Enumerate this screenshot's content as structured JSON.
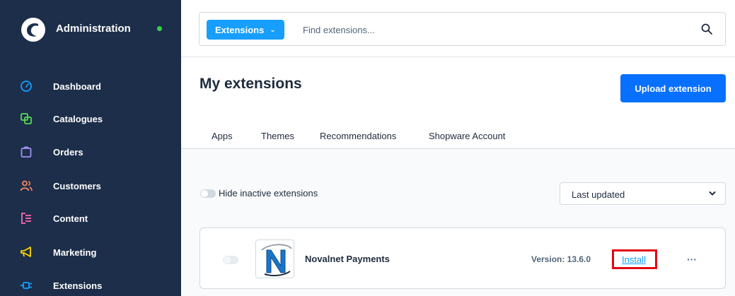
{
  "sidebar": {
    "title": "Administration",
    "status_color": "#37d046",
    "items": [
      {
        "label": "Dashboard",
        "icon": "dashboard-gauge-icon",
        "color": "#189eff"
      },
      {
        "label": "Catalogues",
        "icon": "catalogue-icon",
        "color": "#57d951"
      },
      {
        "label": "Orders",
        "icon": "shopping-bag-icon",
        "color": "#a092f0"
      },
      {
        "label": "Customers",
        "icon": "users-icon",
        "color": "#f88962"
      },
      {
        "label": "Content",
        "icon": "content-icon",
        "color": "#ff68b4"
      },
      {
        "label": "Marketing",
        "icon": "megaphone-icon",
        "color": "#ffd700"
      },
      {
        "label": "Extensions",
        "icon": "plug-icon",
        "color": "#189eff"
      }
    ]
  },
  "search": {
    "type_button_label": "Extensions",
    "placeholder": "Find extensions..."
  },
  "page": {
    "title": "My extensions",
    "upload_label": "Upload extension"
  },
  "tabs": [
    {
      "label": "Apps",
      "active": true
    },
    {
      "label": "Themes",
      "active": false
    },
    {
      "label": "Recommendations",
      "active": false
    },
    {
      "label": "Shopware Account",
      "active": false
    }
  ],
  "filters": {
    "hide_inactive_label": "Hide inactive extensions",
    "sort_value": "Last updated"
  },
  "extension": {
    "name": "Novalnet Payments",
    "version": "Version: 13.6.0",
    "install_label": "Install",
    "more_label": "···"
  },
  "colors": {
    "sidebar_bg": "#1c2e4a",
    "primary": "#0870ff",
    "accent": "#189eff",
    "highlight": "#e30613"
  }
}
